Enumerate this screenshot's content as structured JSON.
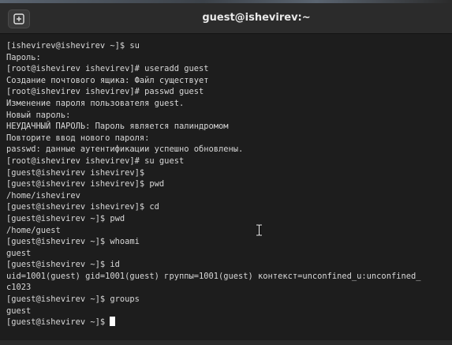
{
  "window": {
    "title": "guest@ishevirev:~"
  },
  "terminal": {
    "lines": [
      "[ishevirev@ishevirev ~]$ su",
      "Пароль:",
      "[root@ishevirev ishevirev]# useradd guest",
      "Создание почтового ящика: Файл существует",
      "[root@ishevirev ishevirev]# passwd guest",
      "Изменение пароля пользователя guest.",
      "Новый пароль:",
      "НЕУДАЧНЫЙ ПАРОЛЬ: Пароль является палиндромом",
      "Повторите ввод нового пароля:",
      "passwd: данные аутентификации успешно обновлены.",
      "[root@ishevirev ishevirev]# su guest",
      "[guest@ishevirev ishevirev]$",
      "[guest@ishevirev ishevirev]$ pwd",
      "/home/ishevirev",
      "[guest@ishevirev ishevirev]$ cd",
      "[guest@ishevirev ~]$ pwd",
      "/home/guest",
      "[guest@ishevirev ~]$ whoami",
      "guest",
      "[guest@ishevirev ~]$ id",
      "uid=1001(guest) gid=1001(guest) группы=1001(guest) контекст=unconfined_u:unconfined_",
      "c1023",
      "[guest@ishevirev ~]$ groups",
      "guest"
    ],
    "prompt": "[guest@ishevirev ~]$ "
  },
  "colors": {
    "background": "#1d1d1d",
    "titlebar": "#2b2b2b",
    "text": "#d8d8d8"
  },
  "icons": {
    "new_tab": "new-tab-icon",
    "pointer": "text-ibeam-icon"
  }
}
